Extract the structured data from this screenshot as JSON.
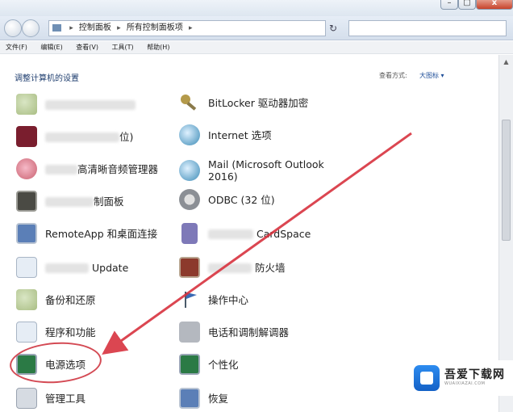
{
  "window": {
    "min_label": "–",
    "max_label": "▢",
    "close_label": "x"
  },
  "nav": {
    "address": [
      "控制面板",
      "所有控制面板项"
    ],
    "search_placeholder": ""
  },
  "menubar": [
    "文件(F)",
    "编辑(E)",
    "查看(V)",
    "工具(T)",
    "帮助(H)"
  ],
  "content": {
    "heading": "调整计算机的设置",
    "view_by_label": "查看方式:",
    "view_by_value": "大图标 ▾"
  },
  "items_left": [
    {
      "label": "",
      "icon": "photo-icon"
    },
    {
      "label": "位)",
      "icon": "flash-icon"
    },
    {
      "label": "高清晰音频管理器",
      "icon": "audio-icon"
    },
    {
      "label": "制面板",
      "icon": "display-icon"
    },
    {
      "label": "RemoteApp 和桌面连接",
      "icon": "remote-desktop-icon"
    },
    {
      "label": "Update",
      "icon": "update-icon"
    },
    {
      "label": "备份和还原",
      "icon": "backup-icon"
    },
    {
      "label": "程序和功能",
      "icon": "programs-icon"
    },
    {
      "label": "电源选项",
      "icon": "power-options-icon"
    },
    {
      "label": "管理工具",
      "icon": "admin-tools-icon"
    }
  ],
  "items_right": [
    {
      "label": "BitLocker 驱动器加密",
      "icon": "key-icon"
    },
    {
      "label": "Internet 选项",
      "icon": "internet-icon"
    },
    {
      "label": "Mail (Microsoft Outlook\n2016)",
      "icon": "mail-icon"
    },
    {
      "label": "ODBC (32 位)",
      "icon": "odbc-icon"
    },
    {
      "label": "CardSpace",
      "icon": "cardspace-icon"
    },
    {
      "label": "防火墙",
      "icon": "firewall-icon"
    },
    {
      "label": "操作中心",
      "icon": "action-center-icon"
    },
    {
      "label": "电话和调制解调器",
      "icon": "phone-modem-icon"
    },
    {
      "label": "个性化",
      "icon": "personalization-icon"
    },
    {
      "label": "恢复",
      "icon": "recovery-icon"
    }
  ],
  "watermark": {
    "title": "吾爱下载网",
    "subtitle": "WUAIXIAZAI.COM"
  }
}
